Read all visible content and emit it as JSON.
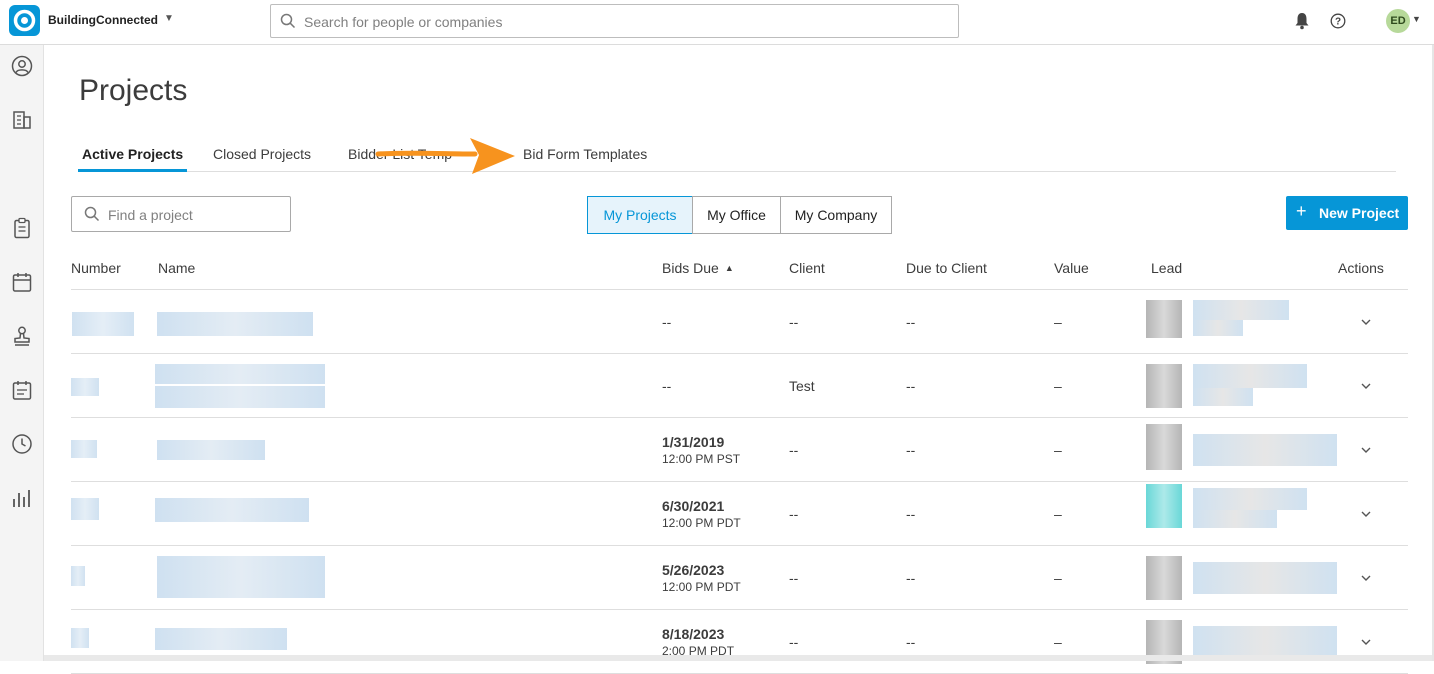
{
  "header": {
    "app_name": "BuildingConnected",
    "search_placeholder": "Search for people or companies",
    "avatar_initials": "ED",
    "colors": {
      "brand": "#0696d7",
      "avatar": "#b7d99a"
    }
  },
  "sidebar": {
    "icons": [
      "user-circle-icon",
      "building-icon",
      "list-icon",
      "clipboard-icon",
      "calendar-icon",
      "stamp-icon",
      "calendar-event-icon",
      "clock-icon",
      "bar-chart-icon"
    ],
    "active": "list-icon"
  },
  "page": {
    "title": "Projects",
    "tabs": [
      {
        "label": "Active Projects",
        "active": true
      },
      {
        "label": "Closed Projects",
        "active": false
      },
      {
        "label": "Bidder List Temp",
        "active": false
      },
      {
        "label": "Bid Form Templates",
        "active": false
      }
    ],
    "find_placeholder": "Find a project",
    "scope_filters": [
      {
        "label": "My Projects",
        "selected": true
      },
      {
        "label": "My Office",
        "selected": false
      },
      {
        "label": "My Company",
        "selected": false
      }
    ],
    "new_project_label": "New Project"
  },
  "table": {
    "columns": [
      "Number",
      "Name",
      "Bids Due",
      "Client",
      "Due to Client",
      "Value",
      "Lead",
      "Actions"
    ],
    "sort_column": "Bids Due",
    "rows": [
      {
        "bids_due_date": "--",
        "bids_due_time": "",
        "client": "--",
        "due_to_client": "--",
        "value": "–"
      },
      {
        "bids_due_date": "--",
        "bids_due_time": "",
        "client": "Test",
        "due_to_client": "--",
        "value": "–"
      },
      {
        "bids_due_date": "1/31/2019",
        "bids_due_time": "12:00 PM PST",
        "client": "--",
        "due_to_client": "--",
        "value": "–"
      },
      {
        "bids_due_date": "6/30/2021",
        "bids_due_time": "12:00 PM PDT",
        "client": "--",
        "due_to_client": "--",
        "value": "–"
      },
      {
        "bids_due_date": "5/26/2023",
        "bids_due_time": "12:00 PM PDT",
        "client": "--",
        "due_to_client": "--",
        "value": "–"
      },
      {
        "bids_due_date": "8/18/2023",
        "bids_due_time": "2:00 PM PDT",
        "client": "--",
        "due_to_client": "--",
        "value": "–"
      }
    ]
  },
  "annotation": {
    "arrow_color": "#f7931e"
  }
}
